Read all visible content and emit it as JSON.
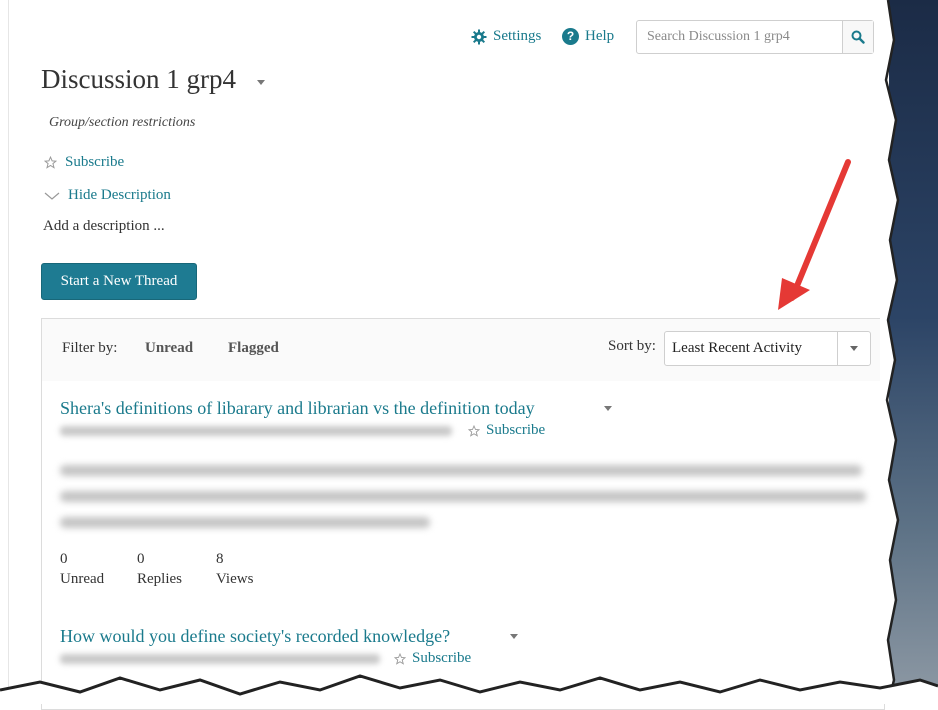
{
  "header": {
    "settings_label": "Settings",
    "help_label": "Help",
    "search_placeholder": "Search Discussion 1 grp4"
  },
  "topic": {
    "title": "Discussion 1 grp4",
    "restrictions": "Group/section restrictions",
    "subscribe_label": "Subscribe",
    "hide_description_label": "Hide Description",
    "description": "Add a description ...",
    "new_thread_button": "Start a New Thread"
  },
  "filter": {
    "label": "Filter by:",
    "options": [
      "Unread",
      "Flagged"
    ]
  },
  "sort": {
    "label": "Sort by:",
    "selected": "Least Recent Activity"
  },
  "threads": [
    {
      "title": "Shera's definitions of libarary and librarian vs the definition today",
      "subscribe_label": "Subscribe",
      "stats": [
        {
          "value": "0",
          "label": "Unread"
        },
        {
          "value": "0",
          "label": "Replies"
        },
        {
          "value": "8",
          "label": "Views"
        }
      ]
    },
    {
      "title": "How would you define society's recorded knowledge?",
      "subscribe_label": "Subscribe"
    }
  ],
  "colors": {
    "link": "#1a7a8c",
    "button": "#1e7b92",
    "arrow": "#e53935"
  },
  "icons": [
    "gear-icon",
    "help-icon",
    "search-icon",
    "caret-down-icon",
    "star-icon",
    "chevron-down-icon"
  ]
}
